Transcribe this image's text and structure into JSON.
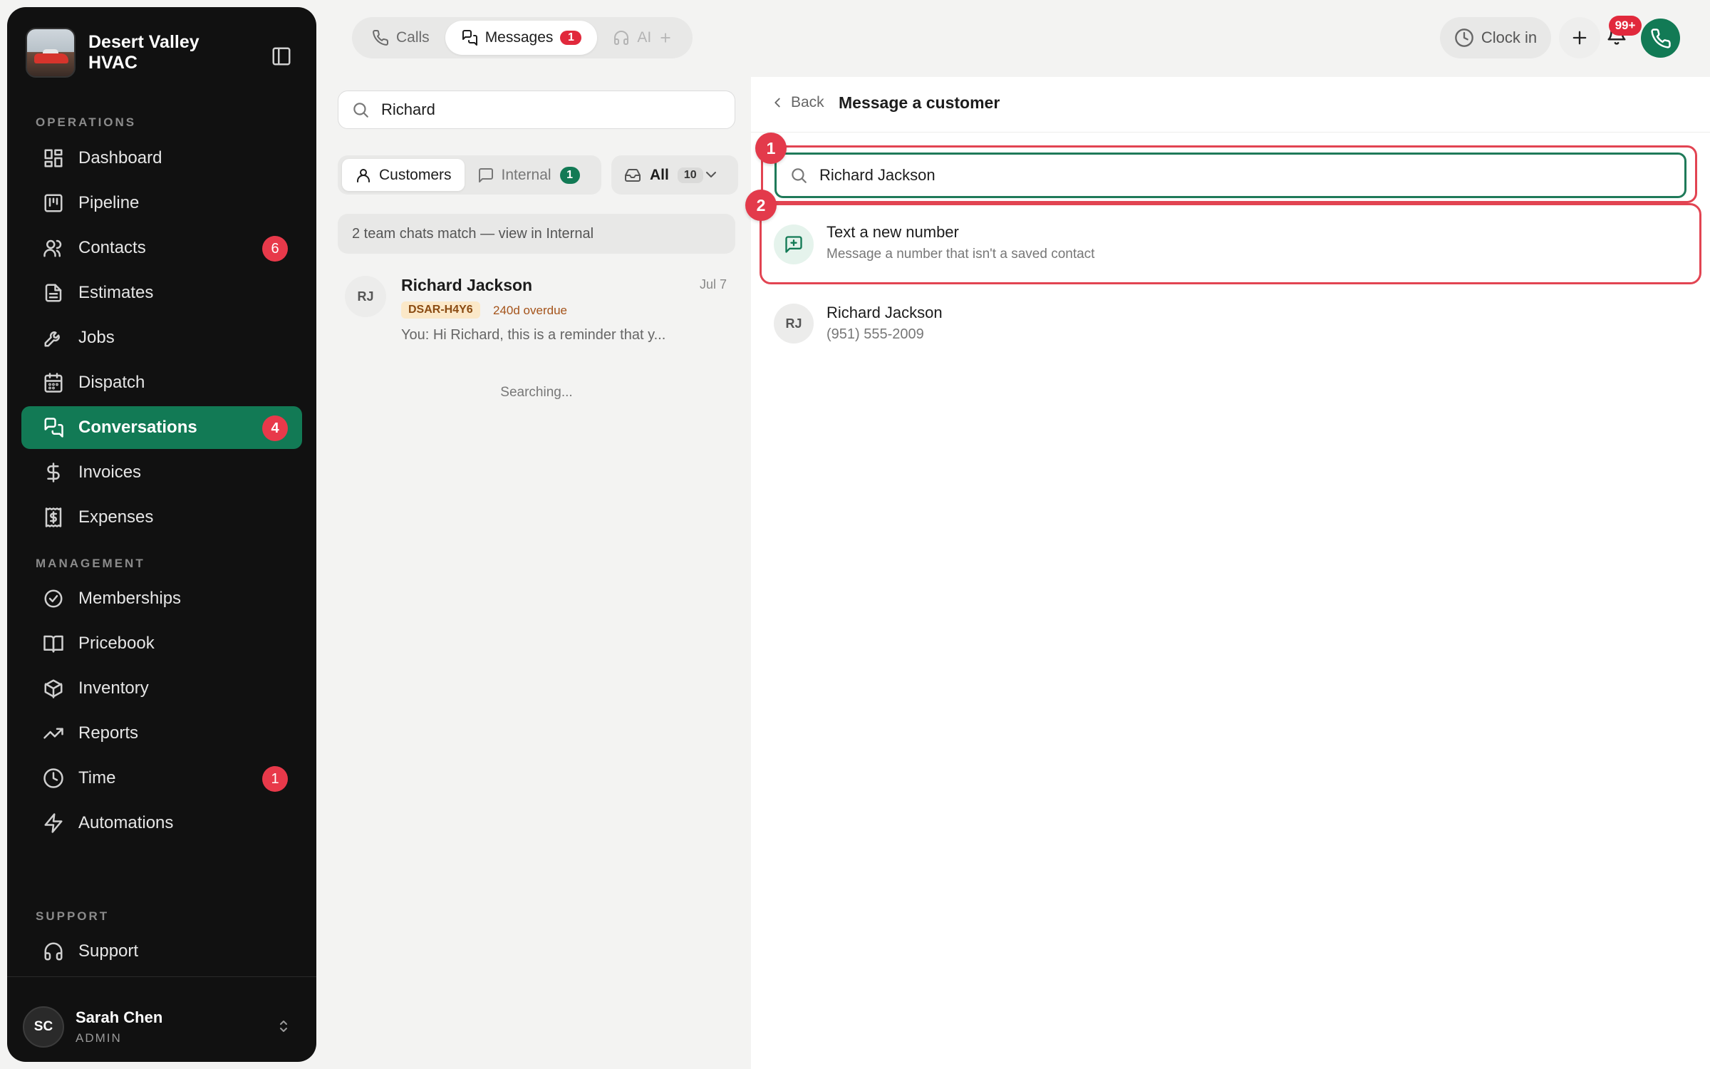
{
  "brand": {
    "name": "Desert Valley HVAC"
  },
  "sidebar": {
    "sections": {
      "operations": "OPERATIONS",
      "management": "MANAGEMENT",
      "support": "SUPPORT"
    },
    "items": [
      {
        "label": "Dashboard",
        "icon": "dashboard-icon"
      },
      {
        "label": "Pipeline",
        "icon": "pipeline-icon"
      },
      {
        "label": "Contacts",
        "icon": "contacts-icon",
        "badge": "6"
      },
      {
        "label": "Estimates",
        "icon": "estimates-icon"
      },
      {
        "label": "Jobs",
        "icon": "wrench-icon"
      },
      {
        "label": "Dispatch",
        "icon": "calendar-icon"
      },
      {
        "label": "Conversations",
        "icon": "chat-icon",
        "badge": "4",
        "active": true
      },
      {
        "label": "Invoices",
        "icon": "dollar-icon"
      },
      {
        "label": "Expenses",
        "icon": "receipt-icon"
      },
      {
        "label": "Memberships",
        "icon": "badge-check-icon"
      },
      {
        "label": "Pricebook",
        "icon": "book-icon"
      },
      {
        "label": "Inventory",
        "icon": "box-icon"
      },
      {
        "label": "Reports",
        "icon": "trending-icon"
      },
      {
        "label": "Time",
        "icon": "clock-icon",
        "badge": "1"
      },
      {
        "label": "Automations",
        "icon": "bolt-icon"
      },
      {
        "label": "Support",
        "icon": "headset-icon"
      }
    ],
    "user": {
      "initials": "SC",
      "name": "Sarah Chen",
      "role": "ADMIN"
    }
  },
  "topbar": {
    "tabs": [
      {
        "label": "Calls"
      },
      {
        "label": "Messages",
        "count": "1"
      },
      {
        "label": "AI"
      }
    ],
    "clock_in": "Clock in",
    "notif_badge": "99+"
  },
  "list": {
    "search_value": "Richard",
    "filters": {
      "customers": "Customers",
      "internal": "Internal",
      "internal_count": "1",
      "all": "All",
      "all_count": "10"
    },
    "team_match": "2 team chats match — view in Internal",
    "conversations": [
      {
        "initials": "RJ",
        "name": "Richard Jackson",
        "date": "Jul 7",
        "tag": "DSAR-H4Y6",
        "overdue": "240d overdue",
        "preview": "You: Hi Richard, this is a reminder that y..."
      }
    ],
    "searching": "Searching..."
  },
  "compose": {
    "back": "Back",
    "title": "Message a customer",
    "search_value": "Richard Jackson",
    "markers": [
      "1",
      "2"
    ],
    "new_number": {
      "title": "Text a new number",
      "subtitle": "Message a number that isn't a saved contact"
    },
    "results": [
      {
        "initials": "RJ",
        "name": "Richard Jackson",
        "phone": "(951) 555-2009"
      }
    ]
  },
  "colors": {
    "accent": "#127a55",
    "badge_red": "#e8394a",
    "highlight": "#e24452",
    "sidebar_bg": "#111111"
  }
}
